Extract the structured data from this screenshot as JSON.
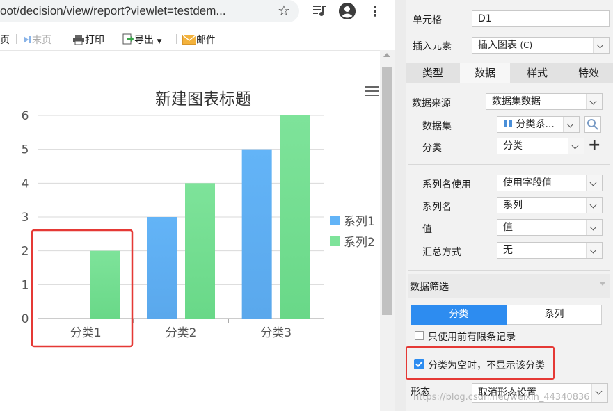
{
  "browser": {
    "url": "oot/decision/view/report?viewlet=testdem...",
    "icons": [
      "star-icon",
      "playlist-icon",
      "account-icon",
      "menu-icon"
    ]
  },
  "toolbar": {
    "prev_page": "页",
    "last_page": "末页",
    "print": "打印",
    "export": "导出",
    "mail": "邮件"
  },
  "chart_data": {
    "type": "bar",
    "title": "新建图表标题",
    "categories": [
      "分类1",
      "分类2",
      "分类3"
    ],
    "series": [
      {
        "name": "系列1",
        "values": [
          null,
          3,
          5
        ],
        "color": "#63b4f7"
      },
      {
        "name": "系列2",
        "values": [
          2,
          4,
          6
        ],
        "color": "#7ee39a"
      }
    ],
    "ylim": [
      0,
      6
    ],
    "yticks": [
      "0",
      "1",
      "2",
      "3",
      "4",
      "5",
      "6"
    ],
    "grid": true,
    "legend": "right",
    "highlight": "分类1"
  },
  "panel": {
    "cell_label": "单元格",
    "cell_value": "D1",
    "insert_label": "插入元素",
    "insert_value": "插入图表",
    "insert_shortcut": "(C)",
    "tabs": [
      "类型",
      "数据",
      "样式",
      "特效"
    ],
    "active_tab": "数据",
    "source_label": "数据来源",
    "source_value": "数据集数据",
    "dataset_label": "数据集",
    "dataset_value": "分类系...",
    "category_label": "分类",
    "category_value": "分类",
    "series_name_use_label": "系列名使用",
    "series_name_use_value": "使用字段值",
    "series_name_label": "系列名",
    "series_name_value": "系列",
    "value_label": "值",
    "value_value": "值",
    "summary_label": "汇总方式",
    "summary_value": "无",
    "filter_label": "数据筛选",
    "filter_tabs": [
      "分类",
      "系列"
    ],
    "only_first_label": "只使用前有限条记录",
    "only_first_checked": false,
    "hide_empty_label": "分类为空时，不显示该分类",
    "hide_empty_checked": true,
    "form_label": "形态",
    "form_value": "取消形态设置",
    "watermark": "https://blog.csdn.net/weixin_44340836"
  },
  "colors": {
    "accent": "#2d8cf0",
    "highlight_box": "#e53935",
    "series1": "#63b4f7",
    "series2": "#7ee39a"
  }
}
